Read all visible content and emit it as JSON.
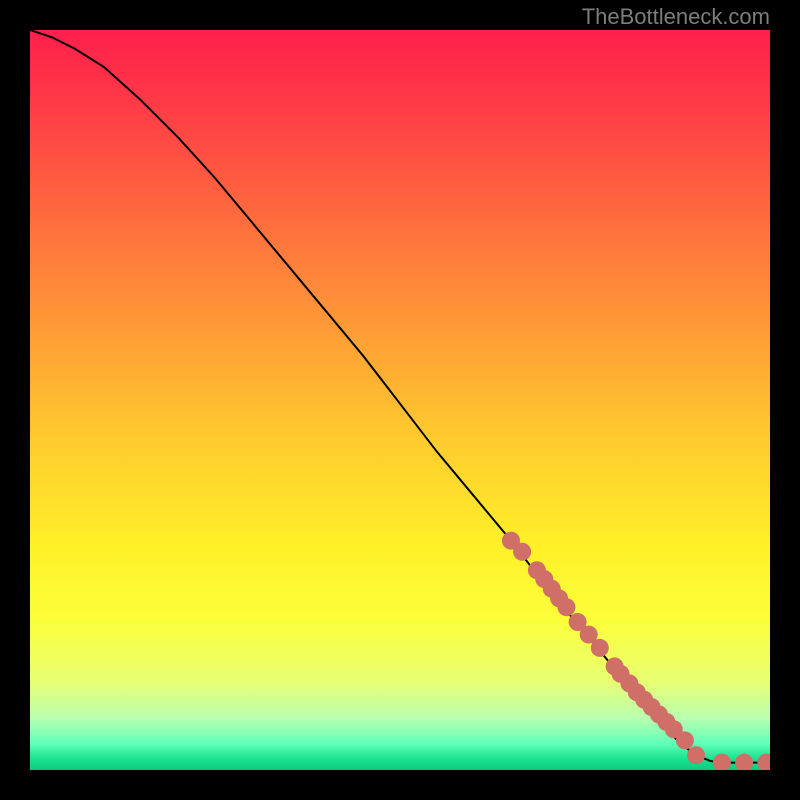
{
  "attribution": "TheBottleneck.com",
  "chart_data": {
    "type": "line",
    "title": "",
    "xlabel": "",
    "ylabel": "",
    "xlim": [
      0,
      100
    ],
    "ylim": [
      0,
      100
    ],
    "curve": {
      "x": [
        0,
        3,
        6,
        10,
        15,
        20,
        25,
        30,
        35,
        40,
        45,
        50,
        55,
        60,
        65,
        70,
        75,
        80,
        85,
        88,
        90,
        92,
        94,
        96,
        98,
        100
      ],
      "y": [
        100,
        99,
        97.5,
        95,
        90.5,
        85.5,
        80,
        74,
        68,
        62,
        56,
        49.5,
        43,
        37,
        31,
        24.5,
        18.5,
        12.5,
        6.5,
        3.5,
        2,
        1.2,
        1,
        1,
        1,
        1
      ]
    },
    "markers": {
      "x": [
        65,
        66.5,
        68.5,
        69.5,
        70.5,
        71.5,
        72.5,
        74,
        75.5,
        77,
        79,
        79.8,
        81,
        82,
        83,
        84,
        85,
        86,
        87,
        88.5,
        90,
        93.5,
        96.5,
        99.5
      ],
      "y": [
        31,
        29.5,
        27,
        25.8,
        24.5,
        23.2,
        22,
        20,
        18.3,
        16.5,
        14,
        13,
        11.7,
        10.5,
        9.5,
        8.5,
        7.5,
        6.5,
        5.5,
        4,
        2,
        1,
        1,
        1
      ]
    },
    "gradient_stops": [
      {
        "offset": 0.0,
        "color": "#ff1f4b"
      },
      {
        "offset": 0.1,
        "color": "#ff3a46"
      },
      {
        "offset": 0.25,
        "color": "#ff6a3e"
      },
      {
        "offset": 0.4,
        "color": "#ff9a36"
      },
      {
        "offset": 0.55,
        "color": "#ffca2e"
      },
      {
        "offset": 0.7,
        "color": "#fff128"
      },
      {
        "offset": 0.8,
        "color": "#fbff3a"
      },
      {
        "offset": 0.88,
        "color": "#e8ff73"
      },
      {
        "offset": 0.93,
        "color": "#b8ffb0"
      },
      {
        "offset": 0.965,
        "color": "#5fffb8"
      },
      {
        "offset": 0.985,
        "color": "#19e28e"
      },
      {
        "offset": 1.0,
        "color": "#11c97e"
      }
    ],
    "marker_color": "#cf6f67",
    "line_color": "#000000"
  }
}
